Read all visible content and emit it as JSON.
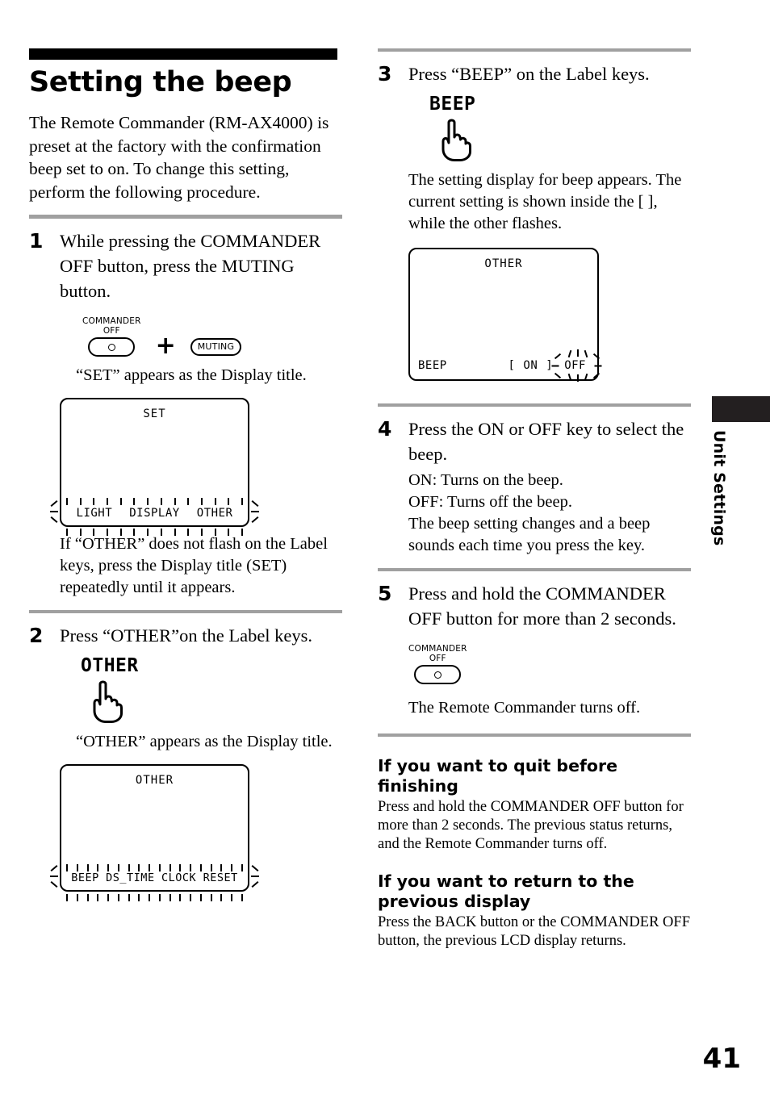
{
  "document": {
    "page_number": "41",
    "side_tab_label": "Unit Settings"
  },
  "heading": {
    "title": "Setting the beep",
    "intro": "The Remote Commander (RM-AX4000) is preset at the factory with the confirmation beep set to on.\nTo change this setting, perform the following procedure."
  },
  "steps": {
    "step1": {
      "number": "1",
      "instruction": "While pressing the COMMANDER OFF button, press the MUTING button.",
      "button_commander_off_line1": "COMMANDER",
      "button_commander_off_line2": "OFF",
      "plus_symbol": "+",
      "button_muting": "MUTING",
      "result": "“SET” appears as the Display title.",
      "note": "If “OTHER” does not flash on the Label keys, press the Display title (SET) repeatedly until it appears."
    },
    "step2": {
      "number": "2",
      "instruction": "Press “OTHER”on the Label keys.",
      "label_key": "OTHER",
      "result": "“OTHER” appears as the Display title."
    },
    "step3": {
      "number": "3",
      "instruction": "Press “BEEP” on the Label keys.",
      "label_key": "BEEP",
      "result": "The setting display for beep appears. The current setting is shown inside the [ ], while the other flashes."
    },
    "step4": {
      "number": "4",
      "instruction": "Press the ON or OFF key to select the beep.",
      "detail_on": "ON: Turns on the beep.",
      "detail_off": "OFF: Turns off the beep.",
      "detail_extra": "The beep setting changes and a beep sounds each time you press the key."
    },
    "step5": {
      "number": "5",
      "instruction": "Press and hold the COMMANDER OFF button for more than 2 seconds.",
      "button_commander_off_line1": "COMMANDER",
      "button_commander_off_line2": "OFF",
      "result": "The Remote Commander turns off."
    }
  },
  "lcd_displays": {
    "display1": {
      "title": "SET",
      "keys": [
        "LIGHT",
        "DISPLAY",
        "OTHER"
      ],
      "flashing": true
    },
    "display2": {
      "title": "OTHER",
      "keys": [
        "BEEP",
        "DS_TIME",
        "CLOCK",
        "RESET"
      ],
      "flashing": true
    },
    "display3": {
      "title": "OTHER",
      "row_label": "BEEP",
      "bracket_open": "[",
      "current_value": "ON",
      "bracket_close": "]",
      "flashing_value": "OFF"
    }
  },
  "sections": [
    {
      "heading": "If you want to quit before finishing",
      "body": "Press and hold the COMMANDER OFF button for more than 2 seconds. The previous status returns, and the Remote Commander turns off."
    },
    {
      "heading": "If you want to return to the previous display",
      "body": "Press the BACK button or the COMMANDER OFF button, the previous LCD display returns."
    }
  ]
}
